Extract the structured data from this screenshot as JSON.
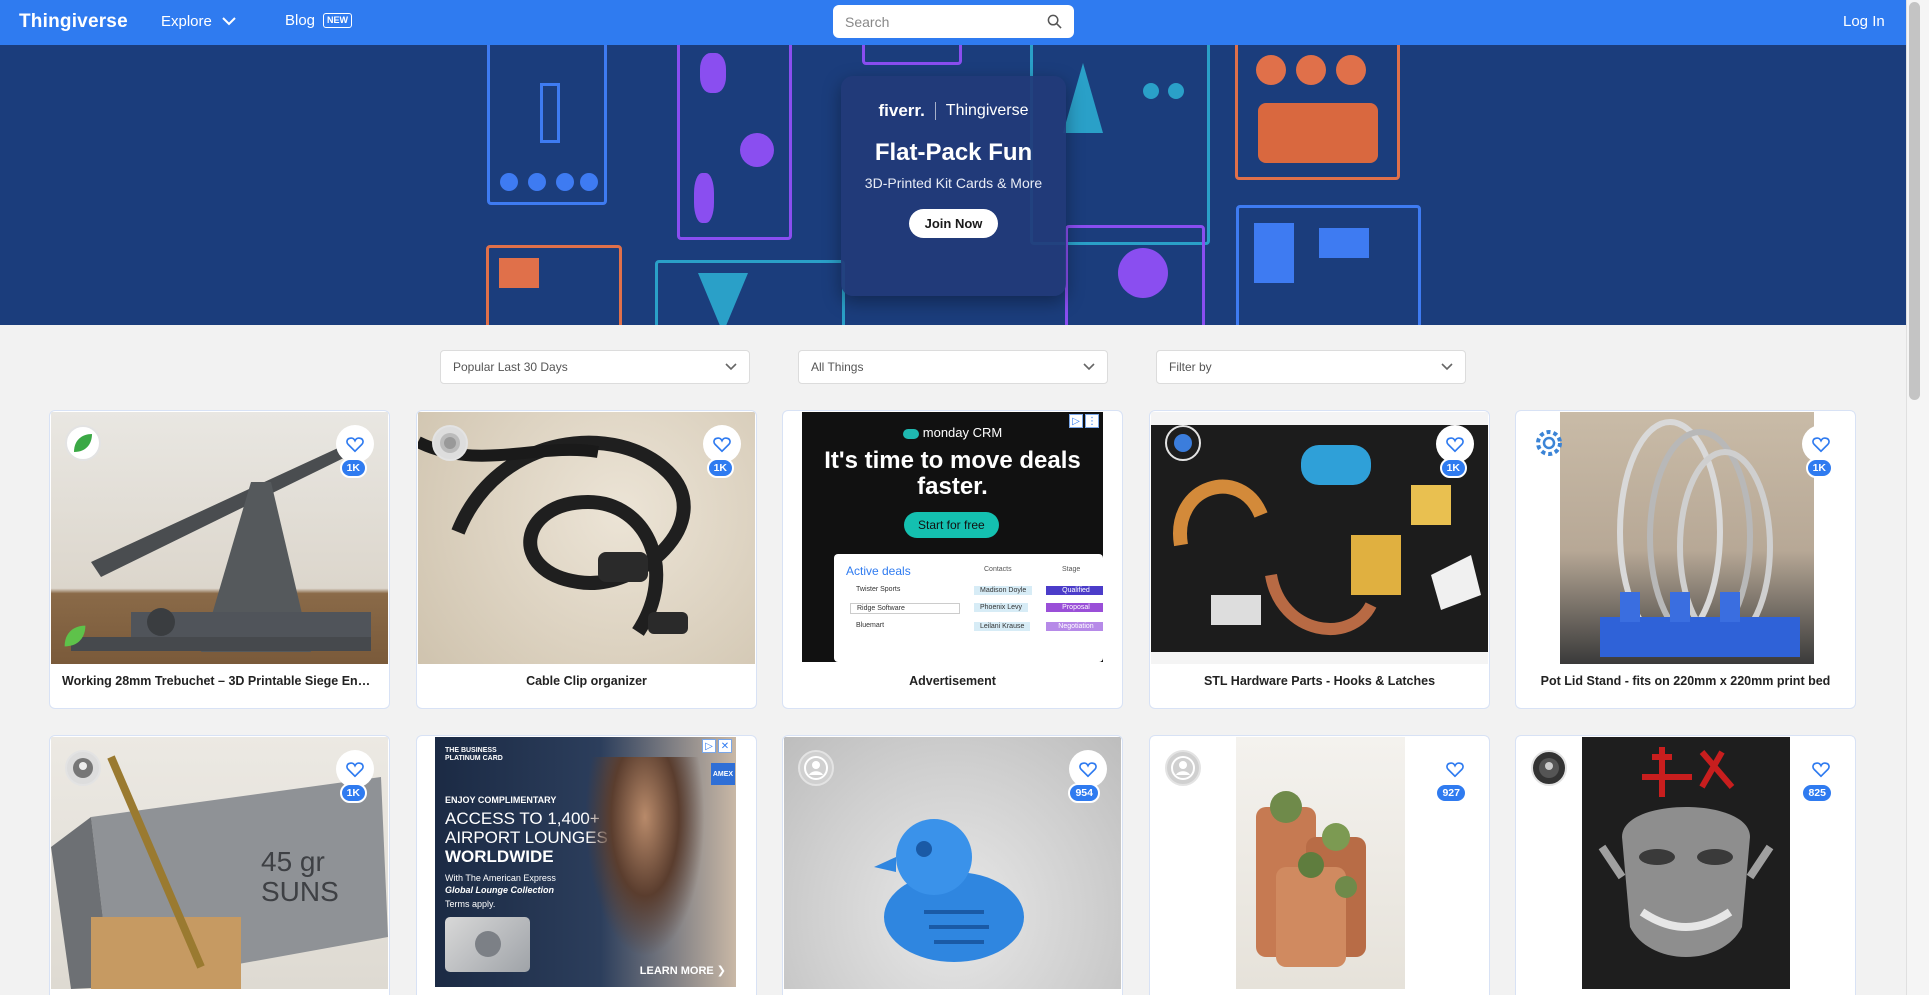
{
  "header": {
    "logo": "Thingiverse",
    "explore": "Explore",
    "blog": "Blog",
    "blog_badge": "NEW",
    "search_placeholder": "Search",
    "login": "Log In"
  },
  "banner": {
    "brand_left": "fiverr.",
    "brand_right": "Thingiverse",
    "title": "Flat-Pack Fun",
    "subtitle": "3D-Printed Kit Cards & More",
    "cta": "Join Now"
  },
  "filters": {
    "sort": "Popular Last 30 Days",
    "type": "All Things",
    "filter": "Filter by"
  },
  "cards": [
    {
      "title": "Working 28mm Trebuchet – 3D Printable Siege Engine …",
      "likes": "1K"
    },
    {
      "title": "Cable Clip organizer",
      "likes": "1K"
    },
    {
      "title": "Advertisement",
      "ad": true
    },
    {
      "title": "STL Hardware Parts - Hooks & Latches",
      "likes": "1K"
    },
    {
      "title": "Pot Lid Stand - fits on 220mm x 220mm print bed",
      "likes": "1K"
    },
    {
      "title": "",
      "likes": "1K"
    },
    {
      "title": "",
      "ad": true
    },
    {
      "title": "",
      "likes": "954"
    },
    {
      "title": "",
      "likes": "927"
    },
    {
      "title": "",
      "likes": "825"
    }
  ],
  "ad_monday": {
    "brand": "monday CRM",
    "headline": "It's time to move deals faster.",
    "cta": "Start for free",
    "table_title": "Active deals",
    "col_contacts": "Contacts",
    "col_stage": "Stage",
    "rows": [
      {
        "name": "Twister Sports",
        "contact": "Madison Doyle",
        "stage": "Qualified"
      },
      {
        "name": "Ridge Software",
        "contact": "Phoenix Levy",
        "stage": "Proposal"
      },
      {
        "name": "Bluemart",
        "contact": "Leilani Krause",
        "stage": "Negotiation"
      }
    ]
  },
  "ad_amex": {
    "card_label": "THE BUSINESS PLATINUM CARD",
    "eyebrow": "ENJOY COMPLIMENTARY",
    "line1": "ACCESS TO 1,400+",
    "line2": "AIRPORT LOUNGES",
    "line3": "WORLDWIDE",
    "fine1": "With The American Express",
    "fine2": "Global Lounge Collection",
    "fine3": "Terms apply.",
    "cta": "LEARN MORE ❯",
    "logo": "AMEX"
  },
  "card6_caption": "45 gr\nSUNS",
  "colors": {
    "accent": "#2f7bf0",
    "banner_bg": "#1b3d7c"
  }
}
